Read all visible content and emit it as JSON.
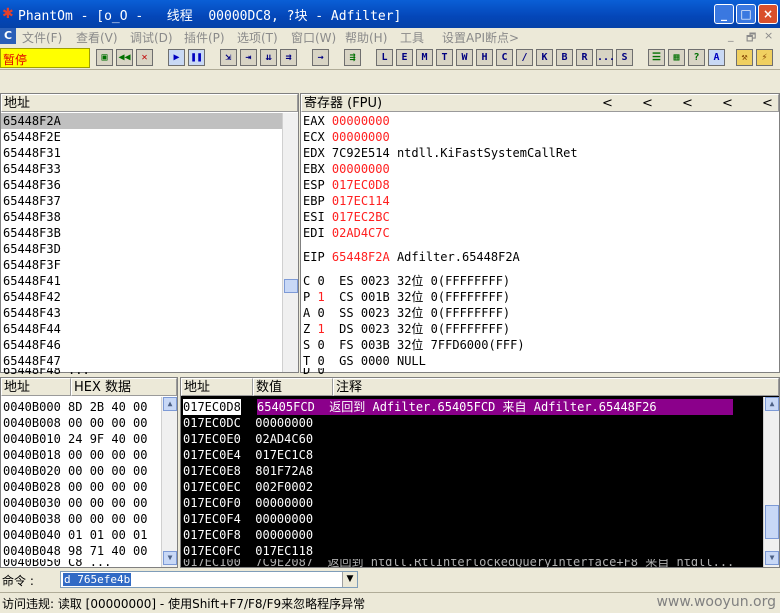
{
  "window": {
    "title": "PhantOm - [o_O -   线程  00000DC8, ?块 - Adfilter]",
    "minimize": "_",
    "maximize": "□",
    "close": "×"
  },
  "menu": [
    "文件(F)",
    "查看(V)",
    "调试(D)",
    "插件(P)",
    "选项(T)",
    "窗口(W)",
    "帮助(H)",
    "工具",
    "设置API断点>"
  ],
  "mdi_controls": [
    "_",
    "🗗",
    "×"
  ],
  "toolbar": {
    "status": "暂停",
    "buttons": [
      "L",
      "E",
      "M",
      "T",
      "W",
      "H",
      "C",
      "/",
      "K",
      "B",
      "R",
      "...",
      "S"
    ]
  },
  "disasm": {
    "header": "地址",
    "rows": [
      "65448F2A",
      "65448F2E",
      "65448F31",
      "65448F33",
      "65448F36",
      "65448F37",
      "65448F38",
      "65448F3B",
      "65448F3D",
      "65448F3F",
      "65448F41",
      "65448F42",
      "65448F43",
      "65448F44",
      "65448F46",
      "65448F47"
    ],
    "partial": "65448F48 ..."
  },
  "registers": {
    "header": "寄存器 (FPU)",
    "arrows": [
      "<",
      "<",
      "<",
      "<",
      "<"
    ],
    "gp": [
      {
        "name": "EAX",
        "value": "00000000",
        "comment": ""
      },
      {
        "name": "ECX",
        "value": "00000000",
        "comment": ""
      },
      {
        "name": "EDX",
        "value": "7C92E514",
        "comment": "ntdll.KiFastSystemCallRet"
      },
      {
        "name": "EBX",
        "value": "00000000",
        "comment": ""
      },
      {
        "name": "ESP",
        "value": "017EC0D8",
        "comment": ""
      },
      {
        "name": "EBP",
        "value": "017EC114",
        "comment": ""
      },
      {
        "name": "ESI",
        "value": "017EC2BC",
        "comment": ""
      },
      {
        "name": "EDI",
        "value": "02AD4C7C",
        "comment": ""
      }
    ],
    "eip": {
      "name": "EIP",
      "value": "65448F2A",
      "comment": "Adfilter.65448F2A"
    },
    "flags": [
      {
        "flag": "C",
        "val": "0",
        "seg": "ES",
        "sel": "0023",
        "bits": "32位",
        "base": "0(FFFFFFFF)"
      },
      {
        "flag": "P",
        "val": "1",
        "seg": "CS",
        "sel": "001B",
        "bits": "32位",
        "base": "0(FFFFFFFF)"
      },
      {
        "flag": "A",
        "val": "0",
        "seg": "SS",
        "sel": "0023",
        "bits": "32位",
        "base": "0(FFFFFFFF)"
      },
      {
        "flag": "Z",
        "val": "1",
        "seg": "DS",
        "sel": "0023",
        "bits": "32位",
        "base": "0(FFFFFFFF)"
      },
      {
        "flag": "S",
        "val": "0",
        "seg": "FS",
        "sel": "003B",
        "bits": "32位",
        "base": "7FFD6000(FFF)"
      },
      {
        "flag": "T",
        "val": "0",
        "seg": "GS",
        "sel": "0000",
        "bits": "NULL",
        "base": ""
      }
    ],
    "partial": "D 0"
  },
  "dump": {
    "headers": [
      "地址",
      "HEX 数据"
    ],
    "rows": [
      {
        "addr": "0040B000",
        "hex": "8D 2B 40 00"
      },
      {
        "addr": "0040B008",
        "hex": "00 00 00 00"
      },
      {
        "addr": "0040B010",
        "hex": "24 9F 40 00"
      },
      {
        "addr": "0040B018",
        "hex": "00 00 00 00"
      },
      {
        "addr": "0040B020",
        "hex": "00 00 00 00"
      },
      {
        "addr": "0040B028",
        "hex": "00 00 00 00"
      },
      {
        "addr": "0040B030",
        "hex": "00 00 00 00"
      },
      {
        "addr": "0040B038",
        "hex": "00 00 00 00"
      },
      {
        "addr": "0040B040",
        "hex": "01 01 00 01"
      },
      {
        "addr": "0040B048",
        "hex": "98 71 40 00"
      }
    ],
    "partial": "0040B050 C8 ..."
  },
  "stack": {
    "headers": [
      "地址",
      "数值",
      "注释"
    ],
    "rows": [
      {
        "addr": "017EC0D8",
        "value": "65405FCD",
        "comment": "返回到 Adfilter.65405FCD 来自 Adfilter.65448F26"
      },
      {
        "addr": "017EC0DC",
        "value": "00000000",
        "comment": ""
      },
      {
        "addr": "017EC0E0",
        "value": "02AD4C60",
        "comment": ""
      },
      {
        "addr": "017EC0E4",
        "value": "017EC1C8",
        "comment": ""
      },
      {
        "addr": "017EC0E8",
        "value": "801F72A8",
        "comment": ""
      },
      {
        "addr": "017EC0EC",
        "value": "002F0002",
        "comment": ""
      },
      {
        "addr": "017EC0F0",
        "value": "00000000",
        "comment": ""
      },
      {
        "addr": "017EC0F4",
        "value": "00000000",
        "comment": ""
      },
      {
        "addr": "017EC0F8",
        "value": "00000000",
        "comment": ""
      },
      {
        "addr": "017EC0FC",
        "value": "017EC118",
        "comment": ""
      }
    ],
    "partial": "017EC100  7C9E2087  返回到 ntdll.RtlInterlockedQueryInterface+F8 来自 ntdll..."
  },
  "command": {
    "label": "命令 :",
    "value": "d 765efe4b"
  },
  "status": "访问违规: 读取 [00000000] - 使用Shift+F7/F8/F9来忽略程序异常",
  "watermark": "www.wooyun.org"
}
